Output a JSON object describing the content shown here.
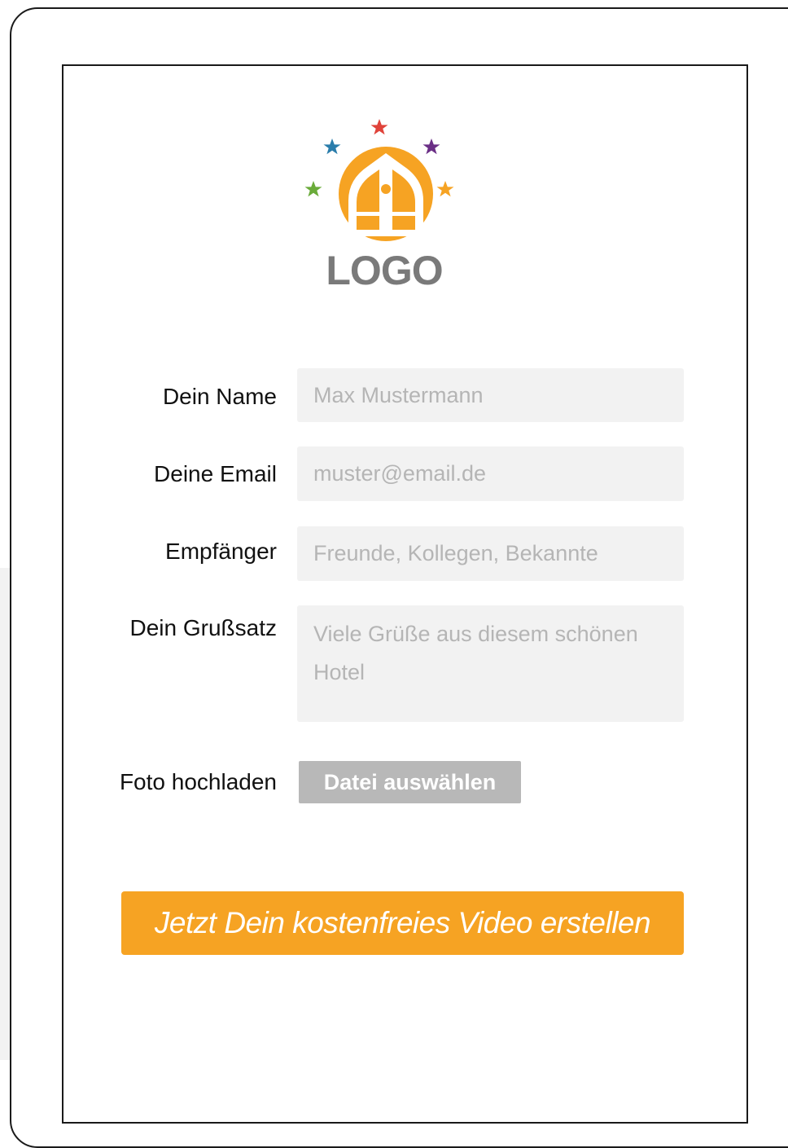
{
  "logo": {
    "text": "LOGO",
    "icon": "hotel-house-with-stars-icon"
  },
  "form": {
    "name": {
      "label": "Dein Name",
      "value": "",
      "placeholder": "Max Mustermann"
    },
    "email": {
      "label": "Deine Email",
      "value": "",
      "placeholder": "muster@email.de"
    },
    "recipient": {
      "label": "Empfänger",
      "value": "",
      "placeholder": "Freunde, Kollegen, Bekannte"
    },
    "greeting": {
      "label": "Dein Grußsatz",
      "value": "",
      "placeholder": "Viele Grüße aus diesem schönen Hotel"
    },
    "photo": {
      "label": "Foto hochladen",
      "button_label": "Datei auswählen"
    }
  },
  "cta": {
    "label": "Jetzt Dein kostenfreies Video erstellen"
  },
  "colors": {
    "accent": "#f6a323",
    "field_background": "#f2f2f2",
    "placeholder_text": "#b5b5b5",
    "file_button": "#b8b8b8",
    "logo_text": "#7a7a7a",
    "star_red": "#e0433a",
    "star_blue": "#2a7dab",
    "star_purple": "#6b2f86",
    "star_green": "#6aab3a",
    "star_orange": "#f6a323"
  }
}
